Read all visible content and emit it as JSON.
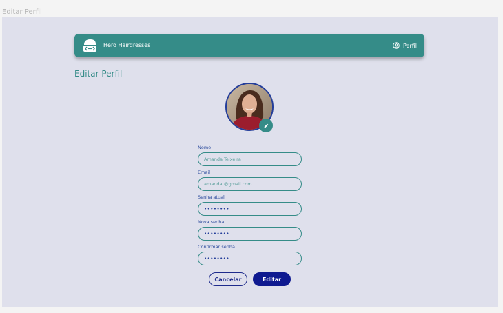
{
  "frame_label": "Editar Perfil",
  "navbar": {
    "brand": "Hero Hairdresses",
    "profile_link": "Perfil",
    "logo_icon": "hairdresser-logo-icon",
    "profile_icon": "user-circle-icon",
    "color": "#358c88"
  },
  "page": {
    "title": "Editar Perfil"
  },
  "avatar": {
    "edit_icon": "pencil-icon"
  },
  "form": {
    "name": {
      "label": "Nome",
      "placeholder": "Amanda Teixeira"
    },
    "email": {
      "label": "Email",
      "placeholder": "amandat@gmail.com"
    },
    "current_password": {
      "label": "Senha atual",
      "value": "••••••••"
    },
    "new_password": {
      "label": "Nova senha",
      "value": "••••••••"
    },
    "confirm_password": {
      "label": "Confirmar senha",
      "value": "••••••••"
    }
  },
  "actions": {
    "cancel": "Cancelar",
    "edit": "Editar"
  },
  "colors": {
    "accent": "#358c88",
    "primary": "#0f1a90",
    "background": "#dfe0ec"
  }
}
